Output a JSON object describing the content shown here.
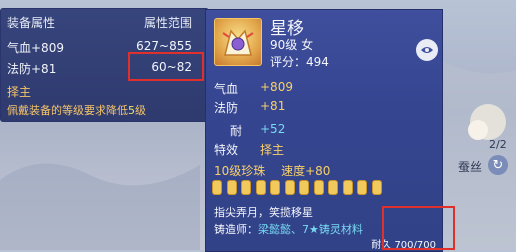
{
  "compare": {
    "header_attr": "装备属性",
    "header_range": "属性范围",
    "rows": [
      {
        "attr": "气血+809",
        "range": "627~855"
      },
      {
        "attr": "法防+81",
        "range": "60~82"
      }
    ],
    "special": "择主",
    "requirement_prefix": "佩戴装备的等级要求降低",
    "requirement_value": "5",
    "requirement_suffix": "级"
  },
  "item": {
    "name": "星移",
    "level": "90级 女",
    "score": "评分：494",
    "stats": [
      {
        "label": "气血",
        "value": "+809"
      },
      {
        "label": "法防",
        "value": "+81"
      },
      {
        "label": "耐",
        "value": "+52"
      },
      {
        "label": "特效",
        "value": "择主"
      }
    ],
    "gem_level": "10级珍珠",
    "gem_bonus": "速度+80",
    "gem_count": 12,
    "quote": "指尖弄月，笑揽移星",
    "smith_label": "铸造师：",
    "smith_name": "梁懿懿、7★铸灵材料",
    "durability": "耐久 700/700"
  },
  "side": {
    "count": "2/2",
    "silk_label": "蚕丝"
  },
  "colors": {
    "panel": "#354590",
    "gold_text": "#f8d06a",
    "cyan_text": "#78d9f2",
    "highlight_box": "#e0302c"
  },
  "icons": [
    "item-icon",
    "eye-icon",
    "refresh-icon"
  ]
}
